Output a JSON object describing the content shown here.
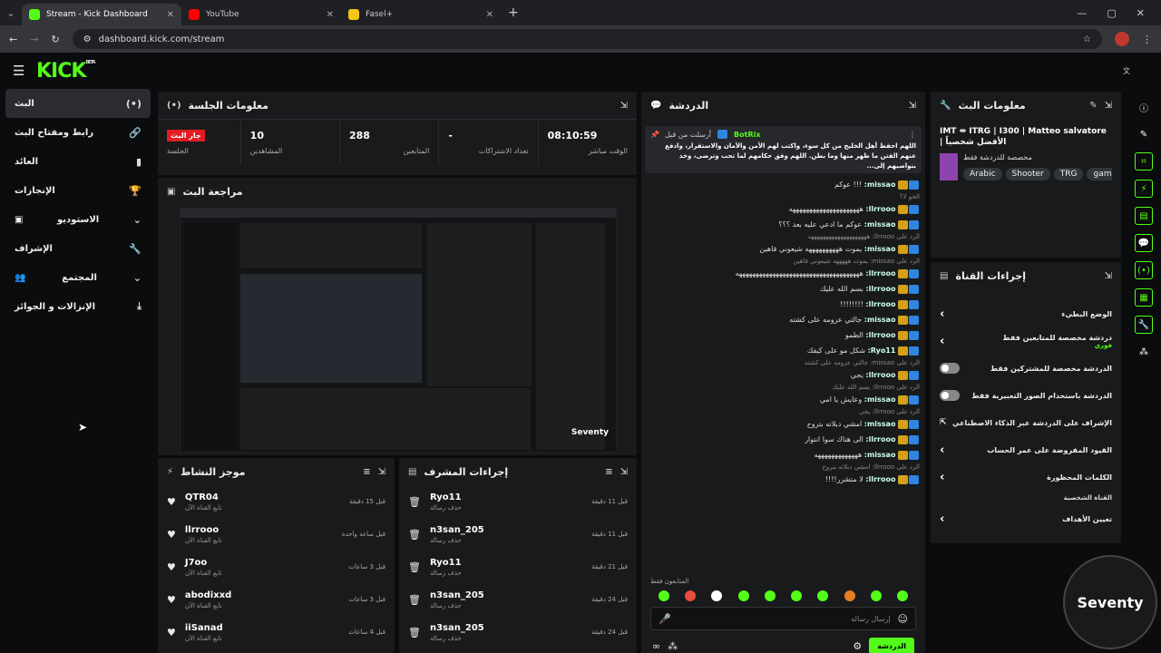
{
  "browser": {
    "tabs": [
      {
        "title": "Stream - Kick Dashboard",
        "color": "#53fc18"
      },
      {
        "title": "YouTube",
        "color": "#ff0000"
      },
      {
        "title": "Fasel+",
        "color": "#f5c518"
      }
    ],
    "url": "dashboard.kick.com/stream"
  },
  "sidebar": {
    "items": [
      {
        "label": "البث",
        "icon": "(•)"
      },
      {
        "label": "رابط ومفتاح البث",
        "icon": "🔗"
      },
      {
        "label": "العائد",
        "icon": "▮"
      },
      {
        "label": "الإنجازات",
        "icon": "🏆"
      },
      {
        "label": "الاستوديو",
        "icon": "▣"
      },
      {
        "label": "الإشراف",
        "icon": "🔧"
      },
      {
        "label": "المجتمع",
        "icon": "👥"
      },
      {
        "label": "الإنزالات و الجوائز",
        "icon": "⤓"
      }
    ]
  },
  "session": {
    "title": "معلومات الجلسة",
    "live_badge": "جار البث",
    "stats": [
      {
        "value": "08:10:59",
        "label": "الوقت مباشر"
      },
      {
        "value": "-",
        "label": "تعداد الاشتراكات"
      },
      {
        "value": "288",
        "label": "المتابعين"
      },
      {
        "value": "10",
        "label": "المشاهدين"
      },
      {
        "value": "",
        "label": "الجلسة"
      }
    ]
  },
  "preview": {
    "title": "مراجعة البث",
    "watermark": "Seventy"
  },
  "activity": {
    "title": "موجز النشاط",
    "items": [
      {
        "name": "QTR04",
        "sub": "تابع القناة الآن",
        "time": "قبل 15 دقيقة"
      },
      {
        "name": "llrrooo",
        "sub": "تابع القناة الآن",
        "time": "قبل ساعة واحدة"
      },
      {
        "name": "J7oo",
        "sub": "تابع القناة الآن",
        "time": "قبل 3 ساعات"
      },
      {
        "name": "abodixxd",
        "sub": "تابع القناة الآن",
        "time": "قبل 3 ساعات"
      },
      {
        "name": "iiSanad",
        "sub": "تابع القناة الآن",
        "time": "قبل 4 ساعات"
      }
    ]
  },
  "modactions": {
    "title": "إجراءات المشرف",
    "items": [
      {
        "name": "Ryo11",
        "sub": "حذف رسالة",
        "time": "قبل 11 دقيقة"
      },
      {
        "name": "n3san_205",
        "sub": "حذف رسالة",
        "time": "قبل 11 دقيقة"
      },
      {
        "name": "Ryo11",
        "sub": "حذف رسالة",
        "time": "قبل 21 دقيقة"
      },
      {
        "name": "n3san_205",
        "sub": "حذف رسالة",
        "time": "قبل 24 دقيقة"
      },
      {
        "name": "n3san_205",
        "sub": "حذف رسالة",
        "time": "قبل 24 دقيقة"
      }
    ]
  },
  "chat": {
    "title": "الدردشة",
    "pinned_by": "أرسلت من قبل",
    "pinned_user": "BotRix",
    "pinned_text": "اللهم احفظ أهل الخليج من كل سوء، واكتب لهم الأمن والأمان والاستقرار، وادفع عنهم الفتن ما ظهر منها وما بطن. اللهم وفق حكامهم لما تحب وترضى، وخذ بنواصيهم إلى...",
    "messages": [
      {
        "user": "missao:",
        "text": "!!! عوكم"
      },
      {
        "reply": "الحو لا؟"
      },
      {
        "user": "llrrooo:",
        "text": "هههههههههههههههههههههه"
      },
      {
        "user": "missao:",
        "text": "عوكم ما ادعي عليه بعد ؟؟؟"
      },
      {
        "reply": "الرد على llrrooo: ههههههههههههههههههههه"
      },
      {
        "user": "missao:",
        "text": "يموت ههههههههههه شيعوني قاهين"
      },
      {
        "reply": "الرد على missao: يموت هههههه شيعوني قاهين"
      },
      {
        "user": "llrrooo:",
        "text": "هههههههههههههههههههههههههههههههههههههه"
      },
      {
        "user": "llrrooo:",
        "text": "بسم الله عليك"
      },
      {
        "user": "llrrooo:",
        "text": "!!!!!!!!"
      },
      {
        "user": "missao:",
        "text": "جالتي عزومه على كشته"
      },
      {
        "user": "llrrooo:",
        "text": "الطمو"
      },
      {
        "user": "Ryo11:",
        "text": "شكل مو على كيفك"
      },
      {
        "reply": "الرد على missao: جالتي عزومه على كشته"
      },
      {
        "user": "llrrooo:",
        "text": "يجي"
      },
      {
        "reply": "الرد على llrrooo: بسم الله عليك"
      },
      {
        "user": "missao:",
        "text": "وعايش يا امي"
      },
      {
        "reply": "الرد على llrrooo: يجي"
      },
      {
        "user": "missao:",
        "text": "امشي دبلاته بتروح"
      },
      {
        "user": "llrrooo:",
        "text": "الى هناك سوا انتوار"
      },
      {
        "user": "missao:",
        "text": "هههههههههههههه"
      },
      {
        "reply": "الرد على llrrooo: امشي دبلاته بتروح"
      },
      {
        "user": "llrrooo:",
        "text": "لا متشرر!!!!"
      }
    ],
    "followers_only": "المتابعون فقط",
    "input_placeholder": "إرسال رسالة",
    "send_label": "الدردشة"
  },
  "streaminfo": {
    "title": "معلومات البث",
    "stream_title": "IMT ⇎ ITRG | I300 | Matteo salvatore | الأفضل شخصياً",
    "category": "مخصصة للدردشة فقط",
    "tags": [
      "Arabic",
      "Shooter",
      "TRG",
      "gamin"
    ]
  },
  "channel": {
    "title": "إجراءات القناة",
    "items": [
      {
        "label": "الوضع البطيء",
        "type": "arrow"
      },
      {
        "label": "دردشة مخصصة للمتابعين فقط",
        "sub": "فوري",
        "type": "arrow"
      },
      {
        "label": "الدردشة مخصصة للمشتركين فقط",
        "type": "toggle"
      },
      {
        "label": "الدردشة باستخدام الصور التعبيرية فقط",
        "type": "toggle"
      },
      {
        "label": "الإشراف على الدردشة عبر الذكاء الاصطناعي",
        "type": "ext"
      },
      {
        "label": "القيود المفروضة على عمر الحساب",
        "type": "arrow"
      },
      {
        "label": "الكلمات المحظورة",
        "type": "arrow"
      }
    ],
    "section": "القناة الشخصية",
    "goal": "تعيين الأهداف"
  },
  "corner_watermark": "Seventy",
  "colors": {
    "brand": "#53fc18",
    "live": "#e31b23"
  }
}
